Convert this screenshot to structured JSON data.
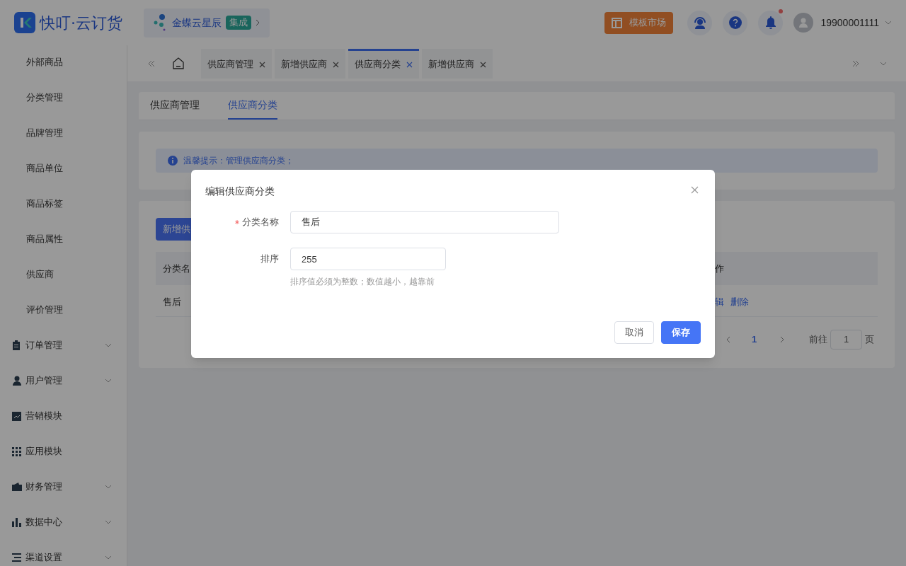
{
  "header": {
    "logo": "快叮·云订货",
    "org": {
      "name": "金蝶云星辰",
      "badge": "集成"
    },
    "market_button": "模板市场",
    "notification_dot": true,
    "user": "19900001111"
  },
  "sidebar": {
    "items": [
      {
        "label": "外部商品",
        "kind": "sub"
      },
      {
        "label": "分类管理",
        "kind": "sub"
      },
      {
        "label": "品牌管理",
        "kind": "sub"
      },
      {
        "label": "商品单位",
        "kind": "sub"
      },
      {
        "label": "商品标签",
        "kind": "sub"
      },
      {
        "label": "商品属性",
        "kind": "sub"
      },
      {
        "label": "供应商",
        "kind": "sub"
      },
      {
        "label": "评价管理",
        "kind": "sub"
      },
      {
        "label": "订单管理",
        "kind": "group",
        "expandable": true
      },
      {
        "label": "用户管理",
        "kind": "group",
        "expandable": true
      },
      {
        "label": "营销模块",
        "kind": "group",
        "expandable": false
      },
      {
        "label": "应用模块",
        "kind": "group",
        "expandable": false
      },
      {
        "label": "财务管理",
        "kind": "group",
        "expandable": true
      },
      {
        "label": "数据中心",
        "kind": "group",
        "expandable": true
      },
      {
        "label": "渠道设置",
        "kind": "group",
        "expandable": true
      }
    ]
  },
  "page_tabs": [
    {
      "label": "供应商管理",
      "selected": false
    },
    {
      "label": "新增供应商",
      "selected": false
    },
    {
      "label": "供应商分类",
      "selected": true
    },
    {
      "label": "新增供应商",
      "selected": false
    }
  ],
  "content": {
    "tabs": [
      {
        "label": "供应商管理",
        "selected": false
      },
      {
        "label": "供应商分类",
        "selected": true
      }
    ],
    "alert": "温馨提示：管理供应商分类；",
    "add_button": "新增供",
    "table": {
      "columns": [
        "分类名",
        "作"
      ],
      "rows": [
        {
          "name": "售后",
          "actions": [
            "辑",
            "删除"
          ]
        }
      ]
    },
    "pagination": {
      "current": "1",
      "goto_label": "前往",
      "goto_value": "1",
      "suffix": "页"
    }
  },
  "dialog": {
    "title": "编辑供应商分类",
    "fields": [
      {
        "label": "分类名称",
        "required": true,
        "value": "售后"
      },
      {
        "label": "排序",
        "required": false,
        "value": "255",
        "hint": "排序值必须为整数；数值越小，越靠前"
      }
    ],
    "buttons": [
      {
        "label": "取消",
        "kind": "default"
      },
      {
        "label": "保存",
        "kind": "primary"
      }
    ]
  }
}
